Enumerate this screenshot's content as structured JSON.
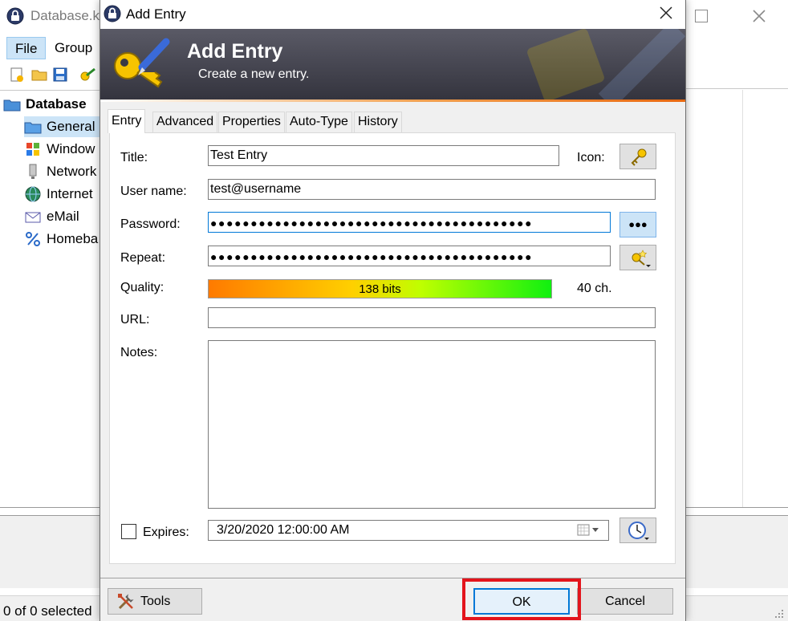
{
  "main_window": {
    "title": "Database.k",
    "menu": {
      "file": "File",
      "group": "Group"
    },
    "tree": {
      "root": "Database",
      "items": [
        "General",
        "Window",
        "Network",
        "Internet",
        "eMail",
        "Homeba"
      ]
    },
    "status": "0 of 0 selected"
  },
  "dialog": {
    "title": "Add Entry",
    "banner_title": "Add Entry",
    "banner_subtitle": "Create a new entry.",
    "tabs": [
      "Entry",
      "Advanced",
      "Properties",
      "Auto-Type",
      "History"
    ],
    "labels": {
      "title": "Title:",
      "icon": "Icon:",
      "username": "User name:",
      "password": "Password:",
      "repeat": "Repeat:",
      "quality": "Quality:",
      "url": "URL:",
      "notes": "Notes:",
      "expires": "Expires:"
    },
    "values": {
      "title": "Test Entry",
      "username": "test@username",
      "password": "●●●●●●●●●●●●●●●●●●●●●●●●●●●●●●●●●●●●●●●●",
      "repeat": "●●●●●●●●●●●●●●●●●●●●●●●●●●●●●●●●●●●●●●●●",
      "url": "",
      "notes": "",
      "expires": "3/20/2020 12:00:00 AM"
    },
    "quality": {
      "text": "138 bits",
      "length": "40 ch."
    },
    "show_password_label": "●●●",
    "buttons": {
      "tools": "Tools",
      "ok": "OK",
      "cancel": "Cancel"
    },
    "expires_checked": false
  },
  "colors": {
    "highlight": "#e3141c",
    "accent_blue": "#0078d7",
    "banner": "#3a3a44"
  }
}
